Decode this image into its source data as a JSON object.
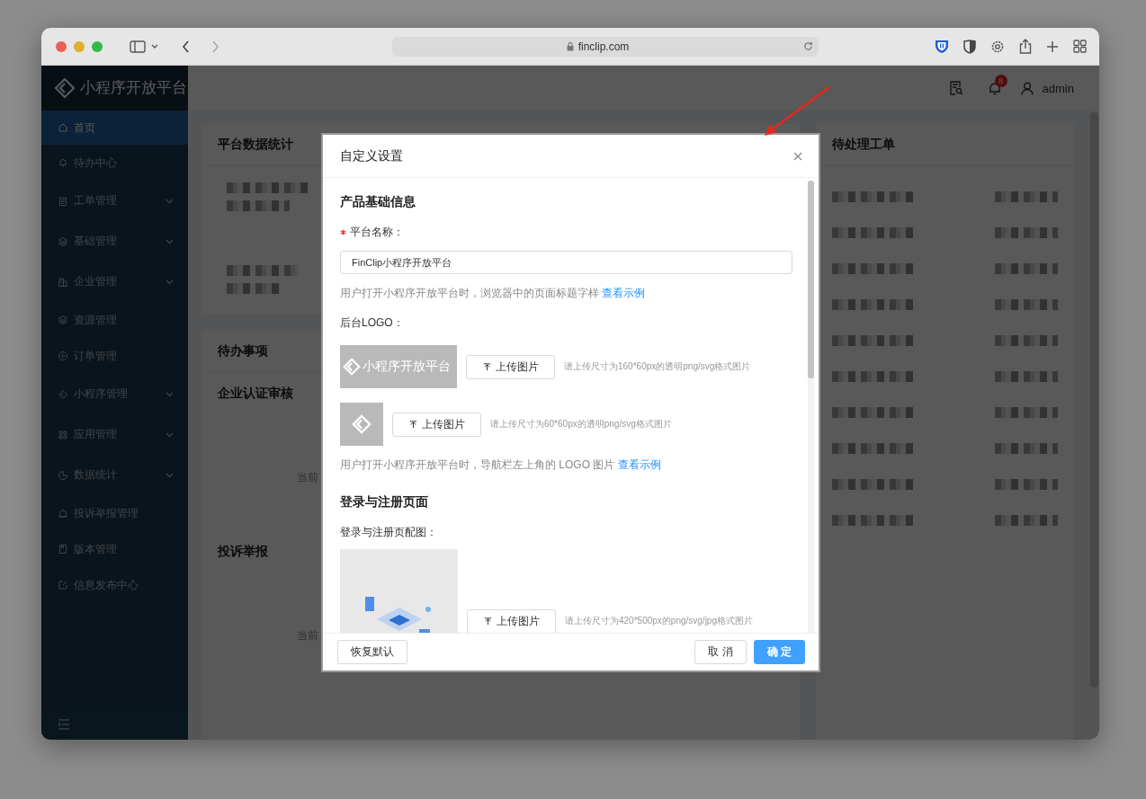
{
  "browser": {
    "url": "finclip.com"
  },
  "sidebar": {
    "logo": "小程序开放平台",
    "items": [
      {
        "label": "首页",
        "selected": true,
        "has_submenu": false
      },
      {
        "label": "待办中心",
        "selected": false,
        "has_submenu": false
      },
      {
        "label": "工单管理",
        "selected": false,
        "has_submenu": true
      },
      {
        "label": "基础管理",
        "selected": false,
        "has_submenu": true
      },
      {
        "label": "企业管理",
        "selected": false,
        "has_submenu": true
      },
      {
        "label": "资源管理",
        "selected": false,
        "has_submenu": false
      },
      {
        "label": "订单管理",
        "selected": false,
        "has_submenu": false
      },
      {
        "label": "小程序管理",
        "selected": false,
        "has_submenu": true
      },
      {
        "label": "应用管理",
        "selected": false,
        "has_submenu": true
      },
      {
        "label": "数据统计",
        "selected": false,
        "has_submenu": true
      },
      {
        "label": "投诉举报管理",
        "selected": false,
        "has_submenu": false
      },
      {
        "label": "版本管理",
        "selected": false,
        "has_submenu": false
      },
      {
        "label": "信息发布中心",
        "selected": false,
        "has_submenu": false
      }
    ]
  },
  "header": {
    "notification_count": "8",
    "user": "admin"
  },
  "dashboard": {
    "stats_title": "平台数据统计",
    "todo_title": "待办事项",
    "sections": [
      {
        "title": "企业认证审核",
        "text": "当前"
      },
      {
        "title": "投诉举报",
        "text": "当前"
      }
    ],
    "tickets_title": "待处理工单"
  },
  "dialog": {
    "title": "自定义设置",
    "basic_section": "产品基础信息",
    "name_field": {
      "label": "平台名称：",
      "required": true,
      "value": "FinClip小程序开放平台",
      "hint": "用户打开小程序开放平台时，浏览器中的页面标题字样",
      "hint_link": "查看示例"
    },
    "logo_field": {
      "label": "后台LOGO：",
      "uploads": [
        {
          "kind": "wide",
          "preview_text": "小程序开放平台",
          "button": "上传图片",
          "hint": "请上传尺寸为160*60px的透明png/svg格式图片"
        },
        {
          "kind": "square",
          "button": "上传图片",
          "hint": "请上传尺寸为60*60px的透明png/svg格式图片"
        }
      ],
      "hint": "用户打开小程序开放平台时，导航栏左上角的 LOGO 图片",
      "hint_link": "查看示例"
    },
    "login_section": "登录与注册页面",
    "cover_field": {
      "label": "登录与注册页配图：",
      "button": "上传图片",
      "hint": "请上传尺寸为420*500px的png/svg/jpg格式图片"
    },
    "footer": {
      "reset": "恢复默认",
      "cancel": "取 消",
      "ok": "确 定"
    }
  }
}
